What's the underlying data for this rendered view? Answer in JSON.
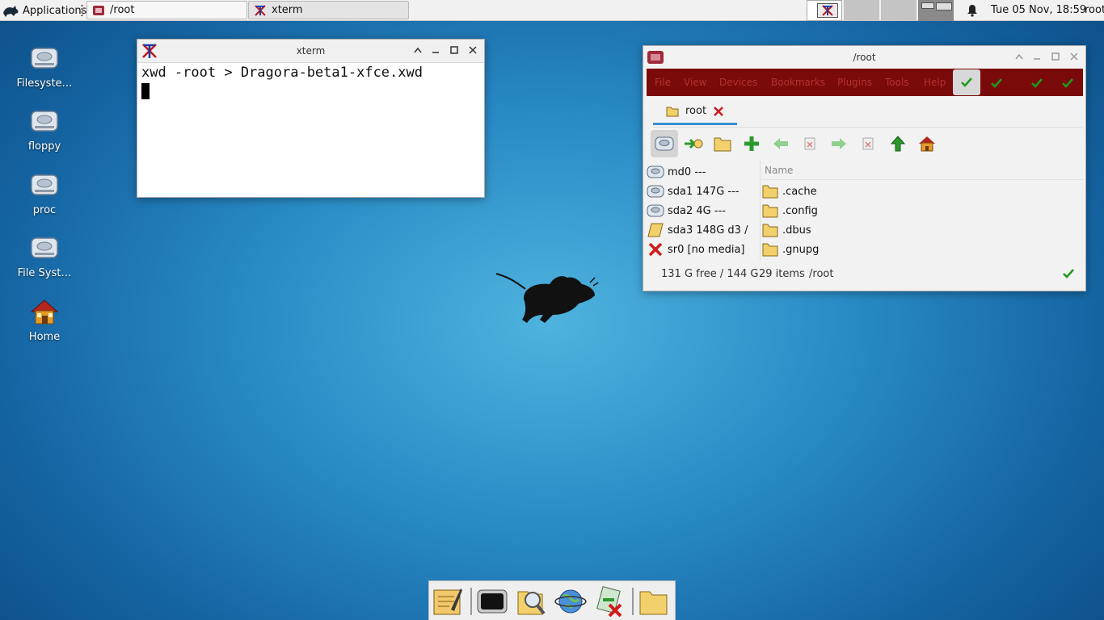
{
  "panel": {
    "applications_label": "Applications",
    "tasks": [
      {
        "label": "/root"
      },
      {
        "label": "xterm"
      }
    ],
    "clock": "Tue 05 Nov, 18:59",
    "user": "root"
  },
  "desktop": {
    "icons": [
      {
        "label": "Filesyste…"
      },
      {
        "label": "floppy"
      },
      {
        "label": "proc"
      },
      {
        "label": "File Syst…"
      },
      {
        "label": "Home"
      }
    ]
  },
  "xterm": {
    "title": "xterm",
    "line1": "xwd -root > Dragora-beta1-xfce.xwd"
  },
  "filemanager": {
    "title": "/root",
    "menu": [
      "File",
      "View",
      "Devices",
      "Bookmarks",
      "Plugins",
      "Tools",
      "Help"
    ],
    "tab_label": "root",
    "devices": [
      {
        "label": "md0 ---"
      },
      {
        "label": "sda1 147G ---"
      },
      {
        "label": "sda2 4G ---"
      },
      {
        "label": "sda3 148G d3 /"
      },
      {
        "label": "sr0 [no media]"
      }
    ],
    "column_name": "Name",
    "files": [
      ".cache",
      ".config",
      ".dbus",
      ".gnupg"
    ],
    "status": {
      "free": "131 G free / 144 G",
      "items": "29 items",
      "path": "/root"
    }
  },
  "colors": {
    "menubar_bg": "#7b0a0a",
    "tab_underline": "#3b8ed8",
    "desktop_center": "#4fb3de",
    "desktop_edge": "#0d4f87"
  }
}
